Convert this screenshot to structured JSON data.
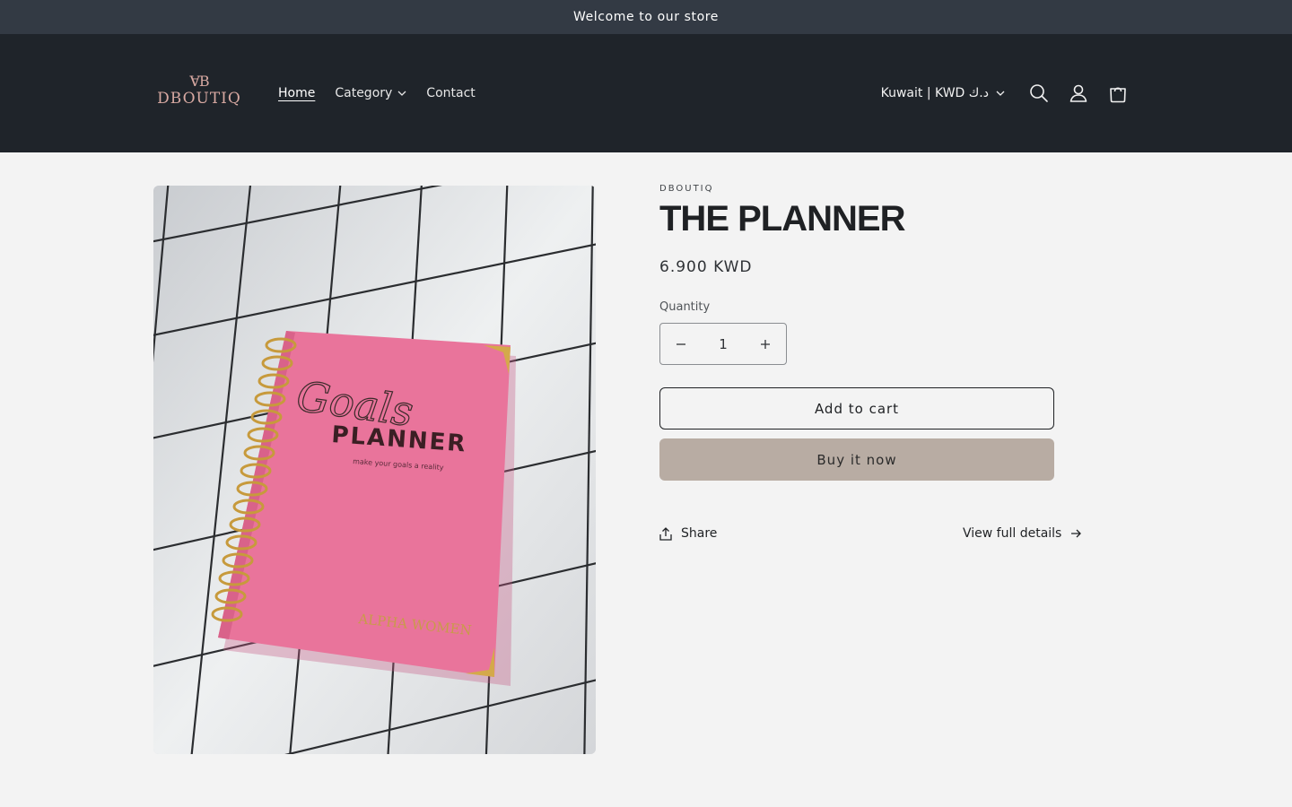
{
  "announcement": {
    "text": "Welcome to our store"
  },
  "header": {
    "logo": {
      "mark": "ⱯB",
      "wordmark": "DBOUTIQ"
    },
    "nav": [
      {
        "label": "Home",
        "active": true
      },
      {
        "label": "Category",
        "has_dropdown": true
      },
      {
        "label": "Contact"
      }
    ],
    "country_selector": "Kuwait | KWD د.ك",
    "icons": [
      "search-icon",
      "account-icon",
      "cart-icon"
    ]
  },
  "product": {
    "vendor": "DBOUTIQ",
    "title": "THE PLANNER",
    "price": "6.900 KWD",
    "quantity_label": "Quantity",
    "quantity": "1",
    "add_to_cart": "Add to cart",
    "buy_now": "Buy it now",
    "share": "Share",
    "view_details": "View full details",
    "image": {
      "cover_script": "Goals",
      "cover_title": "PLANNER",
      "cover_tagline": "make your goals a reality",
      "cover_brand": "ALPHA WOMEN"
    }
  },
  "colors": {
    "announcement_bg": "#333a44",
    "header_bg": "#1f242a",
    "page_bg": "#f3f3f3",
    "buy_now_bg": "#b8aca3",
    "planner_pink": "#e9749b",
    "logo_rose": "#d8a9a2"
  }
}
